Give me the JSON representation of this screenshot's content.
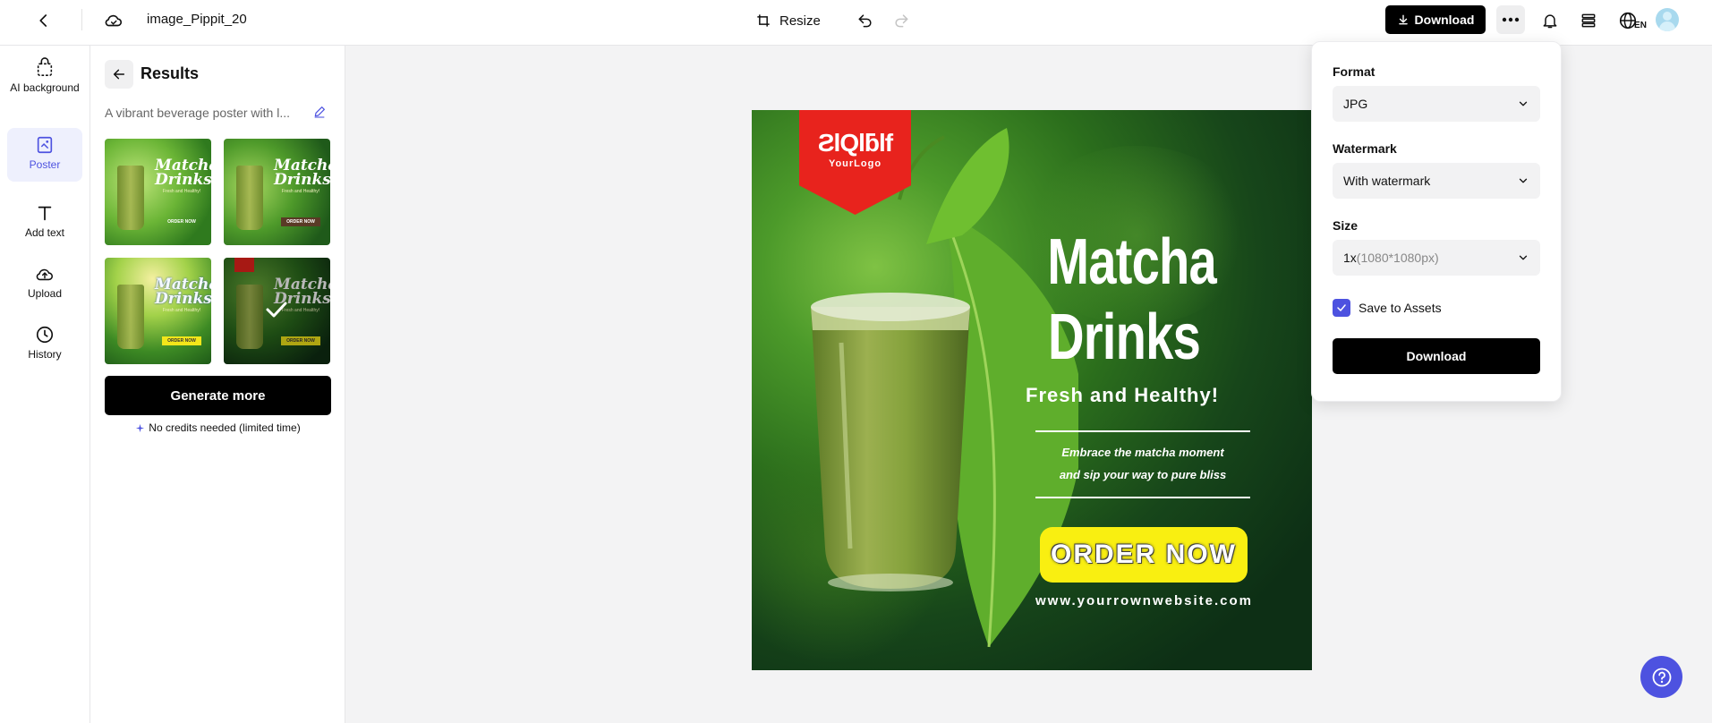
{
  "header": {
    "file_name": "image_Pippit_20",
    "resize_label": "Resize",
    "download_label": "Download",
    "lang_label": "EN"
  },
  "sidebar": {
    "items": [
      {
        "label": "AI background",
        "icon": "ai-background-icon"
      },
      {
        "label": "Poster",
        "icon": "poster-icon",
        "active": true
      },
      {
        "label": "Add text",
        "icon": "text-icon"
      },
      {
        "label": "Upload",
        "icon": "upload-icon"
      },
      {
        "label": "History",
        "icon": "history-icon"
      }
    ]
  },
  "panel": {
    "title": "Results",
    "prompt": "A vibrant beverage poster with l...",
    "generate_label": "Generate more",
    "credits_note": "No credits needed (limited time)",
    "thumbnails": [
      {
        "title": "Matcha Drinks",
        "subtitle": "Fresh and Healthy!",
        "button": "ORDER NOW"
      },
      {
        "title": "Matcha Drinks",
        "subtitle": "Fresh and Healthy!",
        "button": "ORDER NOW"
      },
      {
        "title": "Matcha Drinks",
        "subtitle": "Fresh and Healthy!",
        "button": "ORDER NOW"
      },
      {
        "title": "Matcha Drinks",
        "subtitle": "Fresh and Healthy!",
        "button": "ORDER NOW",
        "selected": true
      }
    ]
  },
  "poster": {
    "logo_main": "ƧlQlƃlf",
    "logo_sub": "YourLogo",
    "title_line1": "Matcha",
    "title_line2": "Drinks",
    "tagline": "Fresh and Healthy!",
    "desc_line1": "Embrace the matcha moment",
    "desc_line2": "and sip your way to pure bliss",
    "order_label": "ORDER NOW",
    "website": "www.yourrownwebsite.com"
  },
  "download_menu": {
    "format_label": "Format",
    "format_value": "JPG",
    "watermark_label": "Watermark",
    "watermark_value": "With watermark",
    "size_label": "Size",
    "size_value": "1x",
    "size_detail": "(1080*1080px)",
    "save_label": "Save to Assets",
    "save_checked": true,
    "download_label": "Download"
  },
  "colors": {
    "accent": "#4d52e0",
    "poster_badge": "#e8231d",
    "order_button": "#f9ef11"
  }
}
